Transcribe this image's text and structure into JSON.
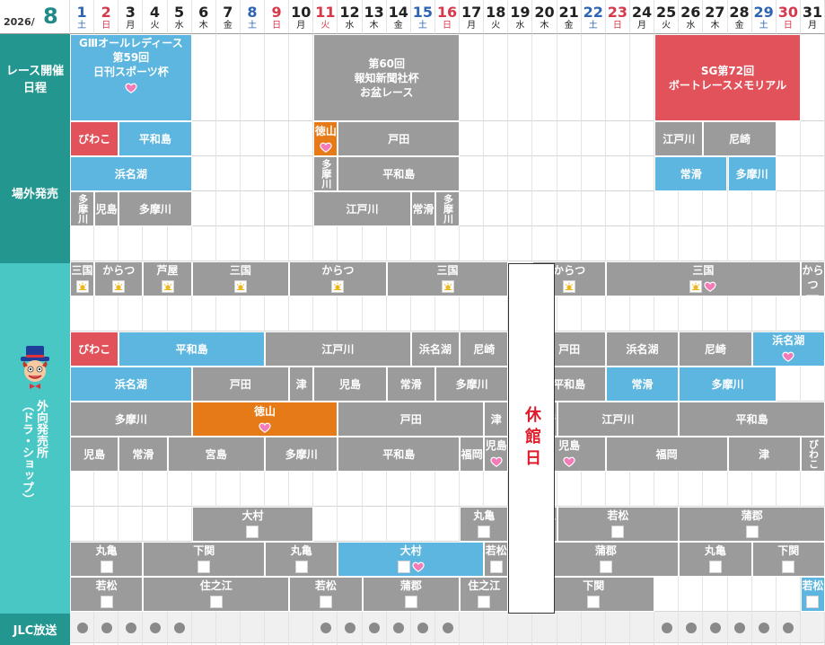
{
  "header": {
    "year": "2026/",
    "month": "8"
  },
  "days": [
    {
      "d": "1",
      "w": "土",
      "c": "sat"
    },
    {
      "d": "2",
      "w": "日",
      "c": "sun"
    },
    {
      "d": "3",
      "w": "月",
      "c": ""
    },
    {
      "d": "4",
      "w": "火",
      "c": ""
    },
    {
      "d": "5",
      "w": "水",
      "c": ""
    },
    {
      "d": "6",
      "w": "木",
      "c": ""
    },
    {
      "d": "7",
      "w": "金",
      "c": ""
    },
    {
      "d": "8",
      "w": "土",
      "c": "sat"
    },
    {
      "d": "9",
      "w": "日",
      "c": "sun"
    },
    {
      "d": "10",
      "w": "月",
      "c": ""
    },
    {
      "d": "11",
      "w": "火",
      "c": "sun"
    },
    {
      "d": "12",
      "w": "水",
      "c": ""
    },
    {
      "d": "13",
      "w": "木",
      "c": ""
    },
    {
      "d": "14",
      "w": "金",
      "c": ""
    },
    {
      "d": "15",
      "w": "土",
      "c": "sat"
    },
    {
      "d": "16",
      "w": "日",
      "c": "sun"
    },
    {
      "d": "17",
      "w": "月",
      "c": ""
    },
    {
      "d": "18",
      "w": "火",
      "c": ""
    },
    {
      "d": "19",
      "w": "水",
      "c": ""
    },
    {
      "d": "20",
      "w": "木",
      "c": ""
    },
    {
      "d": "21",
      "w": "金",
      "c": ""
    },
    {
      "d": "22",
      "w": "土",
      "c": "sat"
    },
    {
      "d": "23",
      "w": "日",
      "c": "sun"
    },
    {
      "d": "24",
      "w": "月",
      "c": ""
    },
    {
      "d": "25",
      "w": "火",
      "c": ""
    },
    {
      "d": "26",
      "w": "水",
      "c": ""
    },
    {
      "d": "27",
      "w": "木",
      "c": ""
    },
    {
      "d": "28",
      "w": "金",
      "c": ""
    },
    {
      "d": "29",
      "w": "土",
      "c": "sat"
    },
    {
      "d": "30",
      "w": "日",
      "c": "sun"
    },
    {
      "d": "31",
      "w": "月",
      "c": ""
    }
  ],
  "sections": {
    "race": "レース開催\n日程",
    "offsite": "場外発売",
    "outside": "外向発売所\n（ドラ・ショップ）",
    "jlc": "JLC放送"
  },
  "closed_label": "休館日",
  "colors": {
    "teal_dark": "#22968f",
    "teal_light": "#48c7c5",
    "blue": "#5cb6df",
    "gray": "#9b9b9b",
    "red": "#e2525a",
    "orange": "#e67a17"
  },
  "blocks": [
    {
      "r": 0,
      "s": 1,
      "e": 5,
      "c": "blue",
      "t": "GⅢオールレディース\n第59回\n日刊スポーツ杯",
      "icons": [
        "heart"
      ],
      "top": true
    },
    {
      "r": 0,
      "s": 11,
      "e": 16,
      "c": "gray",
      "t": "第60回\n報知新聞社杯\nお盆レース"
    },
    {
      "r": 0,
      "s": 25,
      "e": 30,
      "c": "red",
      "t": "SG第72回\nボートレースメモリアル"
    },
    {
      "r": 1,
      "s": 1,
      "e": 2,
      "c": "red",
      "t": "びわこ"
    },
    {
      "r": 1,
      "s": 3,
      "e": 5,
      "c": "blue",
      "t": "平和島"
    },
    {
      "r": 1,
      "s": 11,
      "e": 11,
      "c": "orange",
      "t": "徳山",
      "icons": [
        "heart"
      ]
    },
    {
      "r": 1,
      "s": 12,
      "e": 16,
      "c": "gray",
      "t": "戸田"
    },
    {
      "r": 1,
      "s": 25,
      "e": 26,
      "c": "gray",
      "t": "江戸川"
    },
    {
      "r": 1,
      "s": 27,
      "e": 29,
      "c": "gray",
      "t": "尼崎"
    },
    {
      "r": 2,
      "s": 1,
      "e": 5,
      "c": "blue",
      "t": "浜名湖"
    },
    {
      "r": 2,
      "s": 11,
      "e": 11,
      "c": "gray",
      "t": "多摩川",
      "vert": true
    },
    {
      "r": 2,
      "s": 12,
      "e": 16,
      "c": "gray",
      "t": "平和島"
    },
    {
      "r": 2,
      "s": 25,
      "e": 27,
      "c": "blue",
      "t": "常滑"
    },
    {
      "r": 2,
      "s": 28,
      "e": 29,
      "c": "blue",
      "t": "多摩川"
    },
    {
      "r": 3,
      "s": 1,
      "e": 1,
      "c": "gray",
      "t": "多摩川",
      "vert": true
    },
    {
      "r": 3,
      "s": 2,
      "e": 2,
      "c": "gray",
      "t": "児島"
    },
    {
      "r": 3,
      "s": 3,
      "e": 5,
      "c": "gray",
      "t": "多摩川"
    },
    {
      "r": 3,
      "s": 11,
      "e": 14,
      "c": "gray",
      "t": "江戸川"
    },
    {
      "r": 3,
      "s": 15,
      "e": 15,
      "c": "gray",
      "t": "常滑"
    },
    {
      "r": 3,
      "s": 16,
      "e": 16,
      "c": "gray",
      "t": "多摩川",
      "vert": true
    },
    {
      "r": 5,
      "s": 1,
      "e": 1,
      "c": "gray",
      "t": "三国",
      "icons": [
        "sun"
      ],
      "top": true
    },
    {
      "r": 5,
      "s": 2,
      "e": 3,
      "c": "gray",
      "t": "からつ",
      "icons": [
        "sun"
      ],
      "top": true
    },
    {
      "r": 5,
      "s": 4,
      "e": 5,
      "c": "gray",
      "t": "芦屋",
      "icons": [
        "sun"
      ],
      "top": true
    },
    {
      "r": 5,
      "s": 6,
      "e": 9,
      "c": "gray",
      "t": "三国",
      "icons": [
        "sun"
      ],
      "top": true
    },
    {
      "r": 5,
      "s": 10,
      "e": 13,
      "c": "gray",
      "t": "からつ",
      "icons": [
        "sun"
      ],
      "top": true
    },
    {
      "r": 5,
      "s": 14,
      "e": 18,
      "c": "gray",
      "t": "三国",
      "icons": [
        "sun"
      ],
      "top": true
    },
    {
      "r": 5,
      "s": 20,
      "e": 22,
      "c": "gray",
      "t": "からつ",
      "icons": [
        "sun"
      ],
      "top": true
    },
    {
      "r": 5,
      "s": 23,
      "e": 30,
      "c": "gray",
      "t": "三国",
      "icons": [
        "sun",
        "heart"
      ],
      "top": true
    },
    {
      "r": 5,
      "s": 31,
      "e": 31,
      "c": "gray",
      "t": "からつ",
      "icons": [
        "sun"
      ],
      "top": true
    },
    {
      "r": 7,
      "s": 1,
      "e": 2,
      "c": "red",
      "t": "びわこ"
    },
    {
      "r": 7,
      "s": 3,
      "e": 8,
      "c": "blue",
      "t": "平和島"
    },
    {
      "r": 7,
      "s": 9,
      "e": 14,
      "c": "gray",
      "t": "江戸川"
    },
    {
      "r": 7,
      "s": 15,
      "e": 16,
      "c": "gray",
      "t": "浜名湖"
    },
    {
      "r": 7,
      "s": 17,
      "e": 18,
      "c": "gray",
      "t": "尼崎"
    },
    {
      "r": 7,
      "s": 20,
      "e": 22,
      "c": "gray",
      "t": "戸田"
    },
    {
      "r": 7,
      "s": 23,
      "e": 25,
      "c": "gray",
      "t": "浜名湖"
    },
    {
      "r": 7,
      "s": 26,
      "e": 28,
      "c": "gray",
      "t": "尼崎"
    },
    {
      "r": 7,
      "s": 29,
      "e": 31,
      "c": "blue",
      "t": "浜名湖",
      "icons": [
        "heart"
      ],
      "top": true
    },
    {
      "r": 8,
      "s": 1,
      "e": 5,
      "c": "blue",
      "t": "浜名湖"
    },
    {
      "r": 8,
      "s": 6,
      "e": 9,
      "c": "gray",
      "t": "戸田"
    },
    {
      "r": 8,
      "s": 10,
      "e": 10,
      "c": "gray",
      "t": "津"
    },
    {
      "r": 8,
      "s": 11,
      "e": 13,
      "c": "gray",
      "t": "児島"
    },
    {
      "r": 8,
      "s": 14,
      "e": 15,
      "c": "gray",
      "t": "常滑"
    },
    {
      "r": 8,
      "s": 16,
      "e": 18,
      "c": "gray",
      "t": "多摩川"
    },
    {
      "r": 8,
      "s": 20,
      "e": 22,
      "c": "gray",
      "t": "平和島"
    },
    {
      "r": 8,
      "s": 23,
      "e": 25,
      "c": "blue",
      "t": "常滑"
    },
    {
      "r": 8,
      "s": 26,
      "e": 29,
      "c": "blue",
      "t": "多摩川"
    },
    {
      "r": 9,
      "s": 1,
      "e": 5,
      "c": "gray",
      "t": "多摩川"
    },
    {
      "r": 9,
      "s": 6,
      "e": 11,
      "c": "orange",
      "t": "徳山",
      "icons": [
        "heart"
      ]
    },
    {
      "r": 9,
      "s": 12,
      "e": 17,
      "c": "gray",
      "t": "戸田"
    },
    {
      "r": 9,
      "s": 18,
      "e": 18,
      "c": "gray",
      "t": "津"
    },
    {
      "r": 9,
      "s": 20,
      "e": 20,
      "c": "gray",
      "t": "尼崎"
    },
    {
      "r": 9,
      "s": 21,
      "e": 25,
      "c": "gray",
      "t": "江戸川"
    },
    {
      "r": 9,
      "s": 26,
      "e": 31,
      "c": "gray",
      "t": "平和島"
    },
    {
      "r": 10,
      "s": 1,
      "e": 2,
      "c": "gray",
      "t": "児島"
    },
    {
      "r": 10,
      "s": 3,
      "e": 4,
      "c": "gray",
      "t": "常滑"
    },
    {
      "r": 10,
      "s": 5,
      "e": 8,
      "c": "gray",
      "t": "宮島"
    },
    {
      "r": 10,
      "s": 9,
      "e": 11,
      "c": "gray",
      "t": "多摩川"
    },
    {
      "r": 10,
      "s": 12,
      "e": 16,
      "c": "gray",
      "t": "平和島"
    },
    {
      "r": 10,
      "s": 17,
      "e": 17,
      "c": "gray",
      "t": "福岡"
    },
    {
      "r": 10,
      "s": 18,
      "e": 18,
      "c": "gray",
      "t": "児島",
      "icons": [
        "heart"
      ],
      "top": true
    },
    {
      "r": 10,
      "s": 20,
      "e": 22,
      "c": "gray",
      "t": "児島",
      "icons": [
        "heart"
      ],
      "top": true
    },
    {
      "r": 10,
      "s": 23,
      "e": 27,
      "c": "gray",
      "t": "福岡"
    },
    {
      "r": 10,
      "s": 28,
      "e": 30,
      "c": "gray",
      "t": "津"
    },
    {
      "r": 10,
      "s": 31,
      "e": 31,
      "c": "gray",
      "t": "びわこ",
      "vert": true
    },
    {
      "r": 12,
      "s": 6,
      "e": 10,
      "c": "gray",
      "t": "大村",
      "icons": [
        "moon"
      ],
      "top": true
    },
    {
      "r": 12,
      "s": 17,
      "e": 18,
      "c": "gray",
      "t": "丸亀",
      "icons": [
        "moon"
      ],
      "top": true
    },
    {
      "r": 12,
      "s": 20,
      "e": 20,
      "c": "gray",
      "t": "丸亀",
      "icons": [
        "moon"
      ],
      "top": true
    },
    {
      "r": 12,
      "s": 21,
      "e": 25,
      "c": "gray",
      "t": "若松",
      "icons": [
        "moon"
      ],
      "top": true
    },
    {
      "r": 12,
      "s": 26,
      "e": 31,
      "c": "gray",
      "t": "蒲郡",
      "icons": [
        "moon"
      ],
      "top": true
    },
    {
      "r": 13,
      "s": 1,
      "e": 3,
      "c": "gray",
      "t": "丸亀",
      "icons": [
        "moon"
      ],
      "top": true
    },
    {
      "r": 13,
      "s": 4,
      "e": 8,
      "c": "gray",
      "t": "下関",
      "icons": [
        "moon"
      ],
      "top": true
    },
    {
      "r": 13,
      "s": 9,
      "e": 11,
      "c": "gray",
      "t": "丸亀",
      "icons": [
        "moon"
      ],
      "top": true
    },
    {
      "r": 13,
      "s": 12,
      "e": 17,
      "c": "blue",
      "t": "大村",
      "icons": [
        "moon",
        "heart"
      ],
      "top": true
    },
    {
      "r": 13,
      "s": 18,
      "e": 18,
      "c": "gray",
      "t": "若松",
      "icons": [
        "moon"
      ],
      "top": true
    },
    {
      "r": 13,
      "s": 20,
      "e": 25,
      "c": "gray",
      "t": "蒲郡",
      "icons": [
        "moon"
      ],
      "top": true
    },
    {
      "r": 13,
      "s": 26,
      "e": 28,
      "c": "gray",
      "t": "丸亀",
      "icons": [
        "moon"
      ],
      "top": true
    },
    {
      "r": 13,
      "s": 29,
      "e": 31,
      "c": "gray",
      "t": "下関",
      "icons": [
        "moon"
      ],
      "top": true
    },
    {
      "r": 14,
      "s": 1,
      "e": 3,
      "c": "gray",
      "t": "若松",
      "icons": [
        "moon"
      ],
      "top": true
    },
    {
      "r": 14,
      "s": 4,
      "e": 9,
      "c": "gray",
      "t": "住之江",
      "icons": [
        "moon"
      ],
      "top": true
    },
    {
      "r": 14,
      "s": 10,
      "e": 12,
      "c": "gray",
      "t": "若松",
      "icons": [
        "moon"
      ],
      "top": true
    },
    {
      "r": 14,
      "s": 13,
      "e": 16,
      "c": "gray",
      "t": "蒲郡",
      "icons": [
        "moon"
      ],
      "top": true
    },
    {
      "r": 14,
      "s": 17,
      "e": 18,
      "c": "gray",
      "t": "住之江",
      "icons": [
        "moon"
      ],
      "top": true
    },
    {
      "r": 14,
      "s": 20,
      "e": 24,
      "c": "gray",
      "t": "下関",
      "icons": [
        "moon"
      ],
      "top": true
    },
    {
      "r": 14,
      "s": 31,
      "e": 31,
      "c": "blue",
      "t": "若松",
      "icons": [
        "moon"
      ],
      "top": true
    }
  ],
  "jlc_days": [
    1,
    2,
    3,
    4,
    5,
    11,
    12,
    13,
    14,
    15,
    16,
    25,
    26,
    27,
    28,
    29,
    30
  ]
}
